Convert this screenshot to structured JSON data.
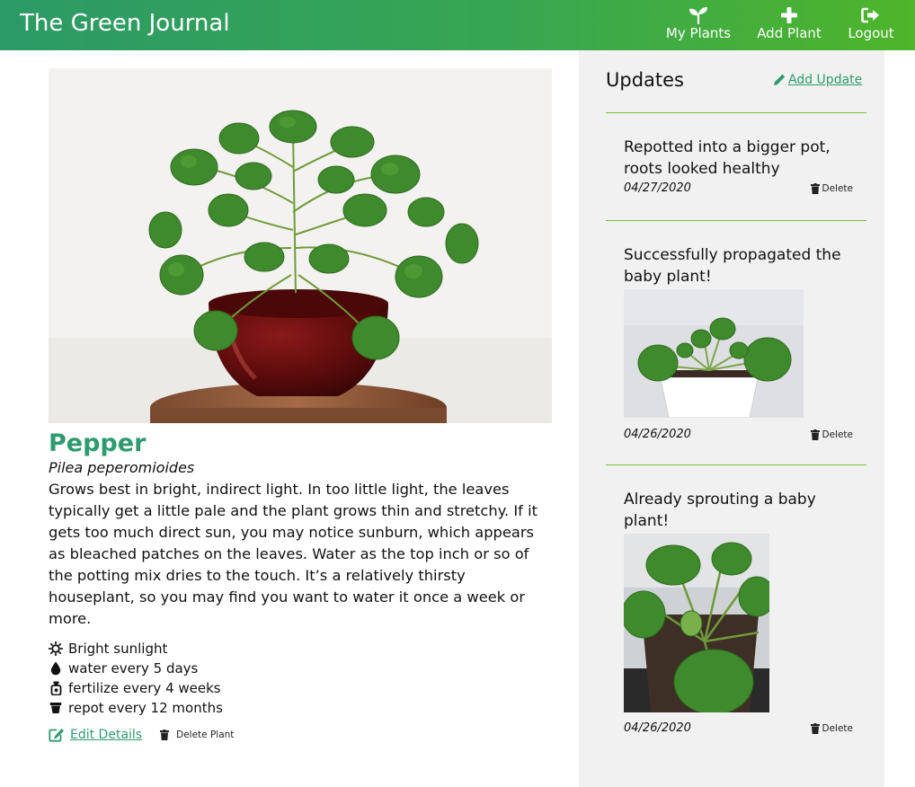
{
  "header": {
    "brand": "The Green Journal",
    "nav": [
      {
        "label": "My Plants",
        "icon": "sprout-icon"
      },
      {
        "label": "Add Plant",
        "icon": "plus-icon"
      },
      {
        "label": "Logout",
        "icon": "logout-icon"
      }
    ]
  },
  "plant": {
    "name": "Pepper",
    "scientific_name": "Pilea peperomioides",
    "description": "Grows best in bright, indirect light. In too little light, the leaves typically get a little pale and the plant grows thin and stretchy. If it gets too much direct sun, you may notice sunburn, which appears as bleached patches on the leaves. Water as the top inch or so of the potting mix dries to the touch. It’s a relatively thirsty houseplant, so you may find you want to water it once a week or more.",
    "care": [
      {
        "icon": "sun-icon",
        "text": "Bright sunlight"
      },
      {
        "icon": "water-drop-icon",
        "text": "water every 5 days"
      },
      {
        "icon": "fertilizer-bottle-icon",
        "text": "fertilize every 4 weeks"
      },
      {
        "icon": "pot-icon",
        "text": "repot every 12 months"
      }
    ],
    "edit_label": "Edit Details",
    "delete_label": "Delete Plant"
  },
  "updates": {
    "title": "Updates",
    "add_label": "Add Update",
    "items": [
      {
        "text": "Repotted into a bigger pot, roots looked healthy",
        "date": "04/27/2020",
        "delete_label": "Delete"
      },
      {
        "text": "Successfully propagated the baby plant!",
        "date": "04/26/2020",
        "delete_label": "Delete"
      },
      {
        "text": "Already sprouting a baby plant!",
        "date": "04/26/2020",
        "delete_label": "Delete"
      }
    ]
  },
  "colors": {
    "header_start": "#2c9a66",
    "header_end": "#4fb52a",
    "accent_green": "#2e9b6e",
    "divider": "#7cbf3d",
    "sidebar_bg": "#f1f1f1"
  }
}
